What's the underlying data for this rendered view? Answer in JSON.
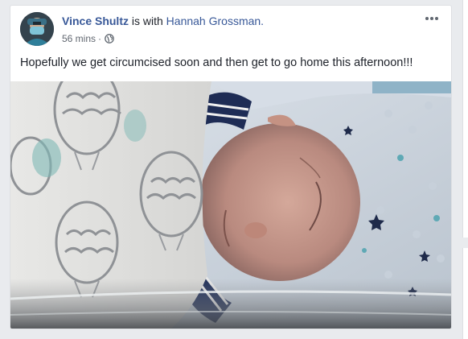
{
  "post": {
    "author": "Vince Shultz",
    "with_text": " is with ",
    "tagged_person": "Hannah Grossman.",
    "timestamp": "56 mins",
    "separator": "·",
    "privacy_icon": "globe-icon",
    "menu_icon": "more-options-icon",
    "message": "Hopefully we get circumcised soon and then get to go home this afternoon!!!",
    "photo_subject": "newborn-photo"
  },
  "colors": {
    "link": "#385898",
    "text": "#1d2129",
    "meta": "#616770",
    "background": "#e9ebee"
  }
}
